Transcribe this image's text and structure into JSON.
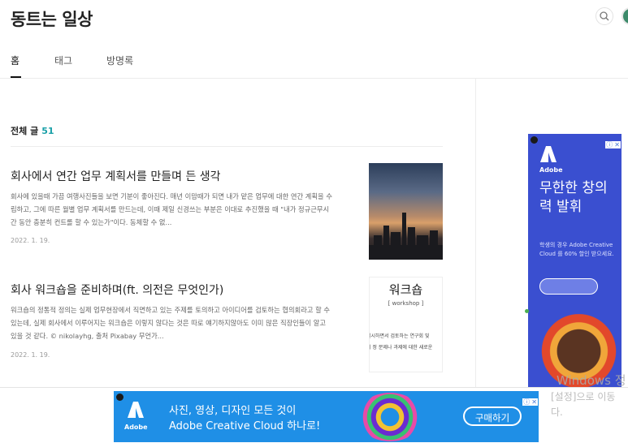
{
  "header": {
    "blog_title": "동트는 일상"
  },
  "nav": {
    "items": [
      {
        "label": "홈",
        "active": true
      },
      {
        "label": "태그",
        "active": false
      },
      {
        "label": "방명록",
        "active": false
      }
    ]
  },
  "post_list": {
    "heading": "전체 글",
    "count": "51",
    "posts": [
      {
        "title": "회사에서 연간 업무 계획서를 만들며 든 생각",
        "excerpt": "회사에 있을때 가끔 여행사진들을 보면 기분이 좋아진다.   매년 이맘때가 되면 내가 맡은 업무에 대한 연간 계획을 수립하고, 그에 따른 월별 업무 계획서를 만드는데, 이때 제일 신경쓰는 부분은 이대로 추진했을 때 \"내가 정규근무시간 동안 충분히 컨트롤 할 수 있는가\"이다.  동체할 수 없...",
        "date": "2022. 1. 19."
      },
      {
        "title": "회사 워크숍을 준비하며(ft. 의전은 무엇인가)",
        "excerpt": " 워크숍의 정통적 정의는 실제 업무현장에서 직면하고 있는 주제를 토의하고 아이디어를 검토하는 협의회라고 할 수 있는데,  실제 회사에서 이루어지는 워크숍은 이렇지 않다는 것은 따로 얘기하지않아도 이미 많은 직장인들이 알고 있을 것 같다.  © nikolayhg, 출처 Pixabay   무언가...",
        "date": "2022. 1. 19."
      }
    ],
    "thumb2": {
      "big_text": "워크숍",
      "small_text": "[ workshop ]",
      "line1": "실시하면서 검토하는 연구회 및",
      "line2": "의 정 문제나 과제에 대한 새로운"
    }
  },
  "side_ad": {
    "brand": "Adobe",
    "headline": "무한한 창의력 발휘",
    "sub": "학생의 경우 Adobe Creative Cloud 를 60% 할인 받으세요."
  },
  "bottom_ad": {
    "brand": "Adobe",
    "line1": "사진, 영상, 디자인 모든 것이",
    "line2": "Adobe Creative Cloud 하나로!",
    "cta": "구매하기"
  },
  "ad_icons": {
    "info": "ⓘ",
    "close": "✕"
  },
  "windows_watermark": {
    "line1": "Windows 정",
    "line2": "[설정]으로 이동",
    "line3": "다."
  },
  "colors": {
    "accent": "#1aa0a8",
    "side_ad_bg": "#3a4fd0",
    "bottom_ad_bg": "#1f8fe6"
  }
}
